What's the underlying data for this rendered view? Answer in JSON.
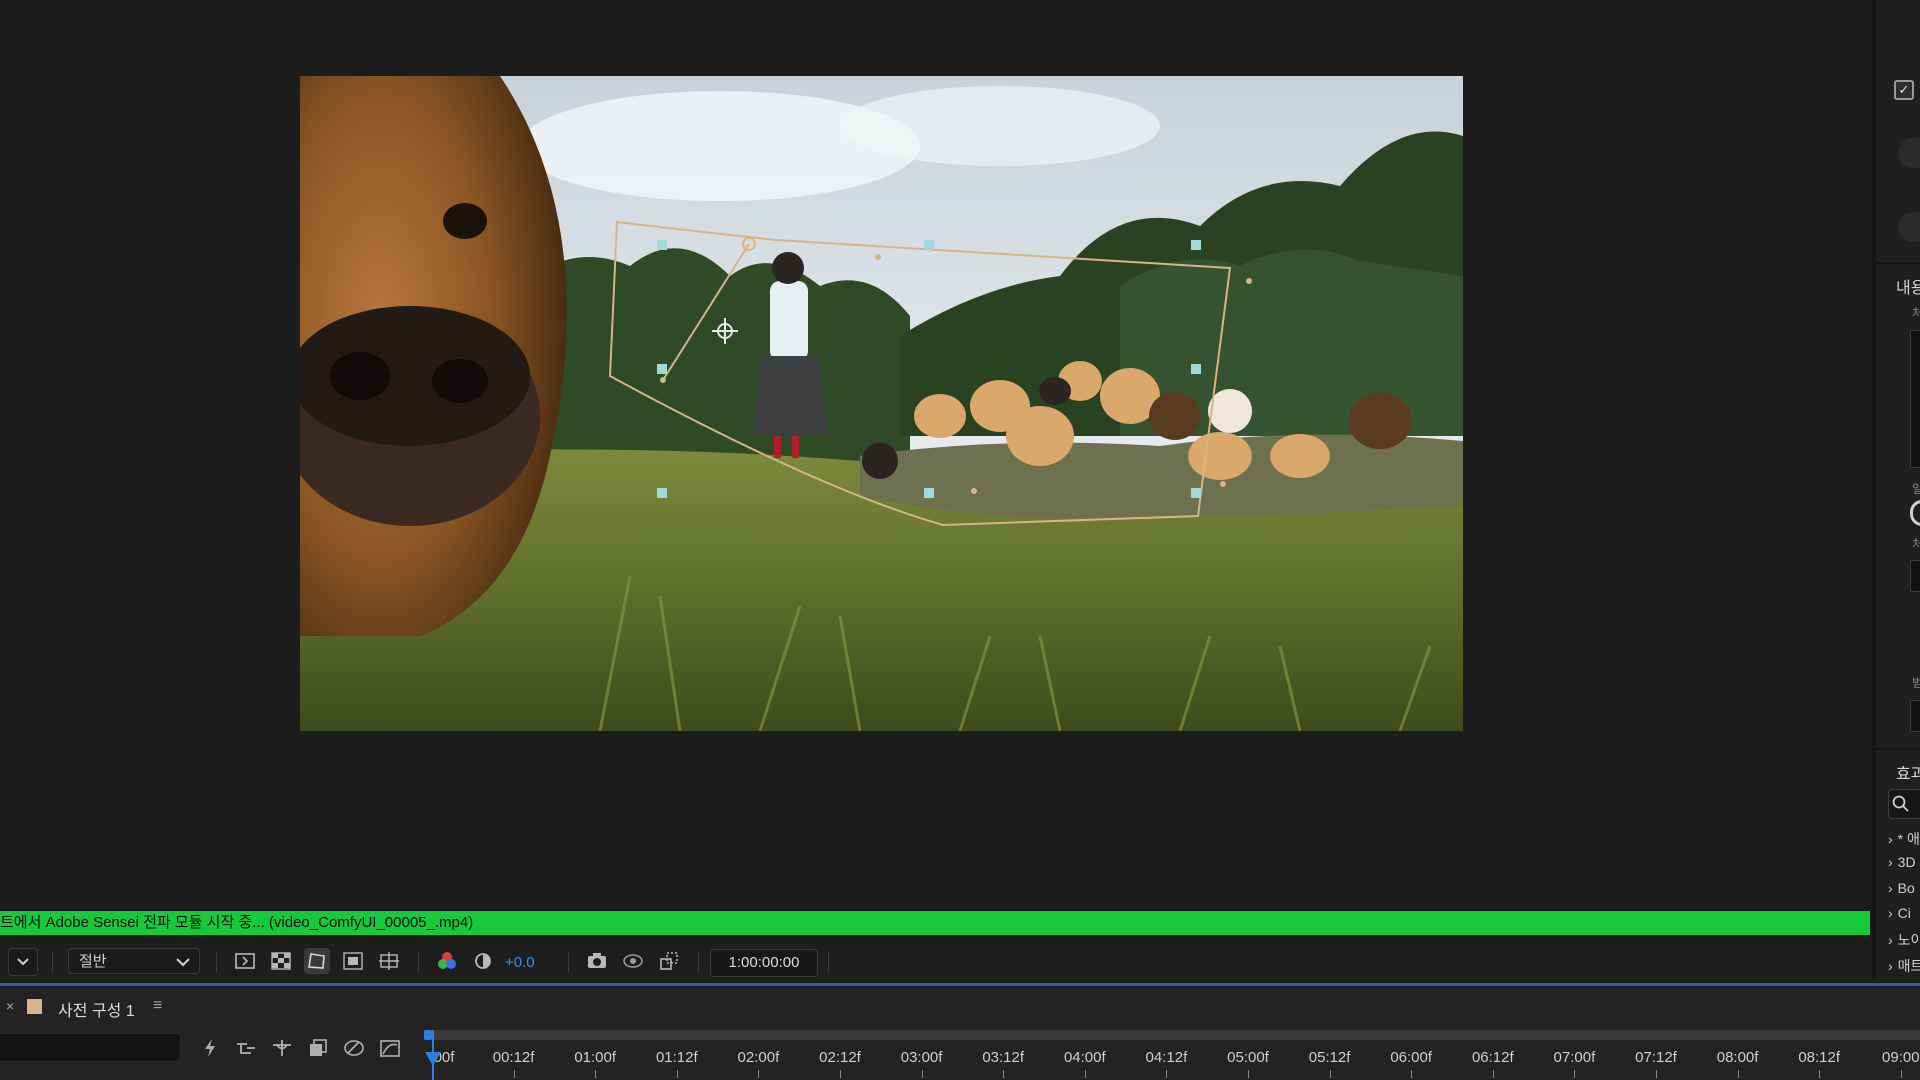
{
  "viewer": {
    "image_description_icon": "puppies-in-grass-frame"
  },
  "right_panel": {
    "section_content_label": "내용",
    "section_content_sub": "처",
    "small_labels": [
      "일",
      "처",
      "범"
    ],
    "effects_label": "효과",
    "search_icon": "search-icon",
    "tree_items": [
      "* 애",
      "3D",
      "Bo",
      "Ci",
      "노이",
      "매트"
    ]
  },
  "status_bar": {
    "text": "트에서 Adobe Sensei 전파 모듈 시작 중... (video_ComfyUI_00005_.mp4)"
  },
  "toolbar": {
    "resolution_label": "절반",
    "exposure_value": "+0.0",
    "timecode": "1:00:00:00"
  },
  "timeline": {
    "comp_tab": {
      "close": "×",
      "title": "사전 구성 1",
      "menu": "≡"
    },
    "ticks": [
      "00f",
      "00:12f",
      "01:00f",
      "01:12f",
      "02:00f",
      "02:12f",
      "03:00f",
      "03:12f",
      "04:00f",
      "04:12f",
      "05:00f",
      "05:12f",
      "06:00f",
      "06:12f",
      "07:00f",
      "07:12f",
      "08:00f",
      "08:12f",
      "09:00"
    ]
  },
  "colors": {
    "status_green": "#18c93c",
    "accent_blue": "#2f7fe0",
    "mask_path": "#d6b48a",
    "handle": "#9fd9d9"
  }
}
